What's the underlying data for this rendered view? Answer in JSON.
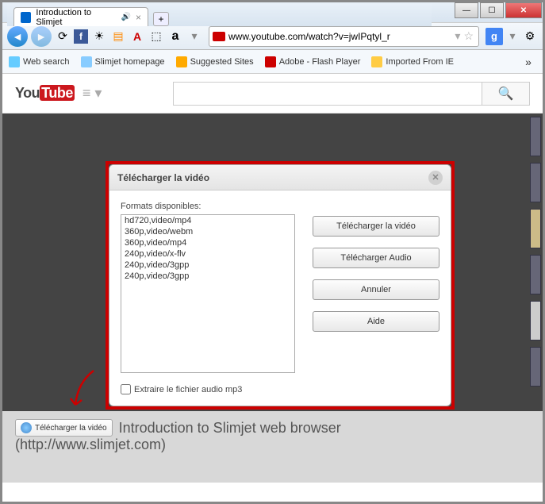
{
  "tab": {
    "title": "Introduction to Slimjet"
  },
  "address": {
    "url": "www.youtube.com/watch?v=jwIPqtyl_r"
  },
  "bookmarks": {
    "web_search": "Web search",
    "slimjet_home": "Slimjet homepage",
    "suggested": "Suggested Sites",
    "adobe": "Adobe - Flash Player",
    "imported": "Imported From IE"
  },
  "dialog": {
    "title": "Télécharger la vidéo",
    "formats_label": "Formats disponibles:",
    "formats": [
      "hd720,video/mp4",
      "360p,video/webm",
      "360p,video/mp4",
      "240p,video/x-flv",
      "240p,video/3gpp",
      "240p,video/3gpp"
    ],
    "btn_video": "Télécharger la vidéo",
    "btn_audio": "Télécharger Audio",
    "btn_cancel": "Annuler",
    "btn_help": "Aide",
    "extract": "Extraire le fichier audio mp3"
  },
  "info": {
    "button_label": "Télécharger la vidéo",
    "title": "Introduction to Slimjet web browser",
    "url": "(http://www.slimjet.com)"
  }
}
